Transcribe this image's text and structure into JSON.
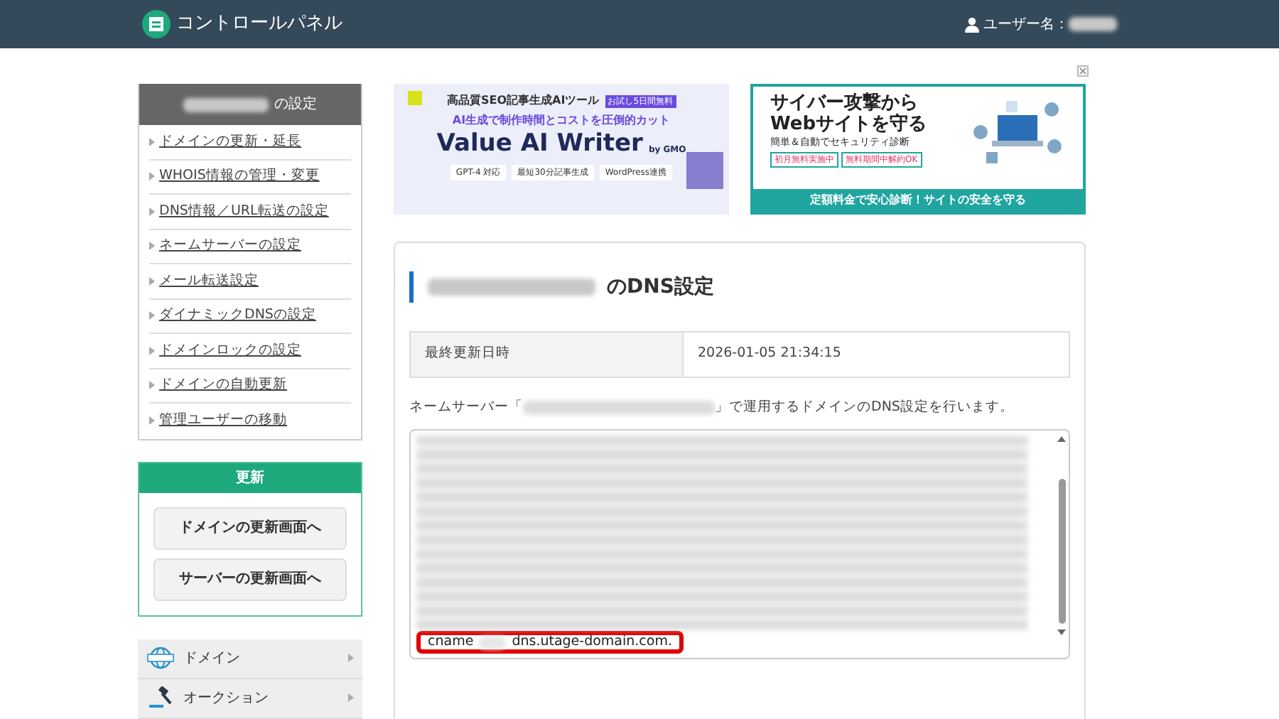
{
  "header": {
    "title": "コントロールパネル",
    "user_label": "ユーザー名："
  },
  "sidebar": {
    "settings_title_suffix": "の設定",
    "links": [
      "ドメインの更新・延長",
      "WHOIS情報の管理・変更",
      "DNS情報／URL転送の設定",
      "ネームサーバーの設定",
      "メール転送設定",
      "ダイナミックDNSの設定",
      "ドメインロックの設定",
      "ドメインの自動更新",
      "管理ユーザーの移動"
    ],
    "update_panel": {
      "title": "更新",
      "buttons": [
        "ドメインの更新画面へ",
        "サーバーの更新画面へ"
      ]
    },
    "category_menu": [
      {
        "kind": "domain",
        "label": "ドメイン"
      },
      {
        "kind": "auction",
        "label": "オークション"
      }
    ]
  },
  "ads": [
    {
      "kind": "seo",
      "headline": "高品質SEO記事生成AIツール",
      "badge": "お試し5日間無料",
      "tagline": "AI生成で制作時間とコストを圧倒的カット",
      "product": "Value AI Writer",
      "maker": "by GMO",
      "features": [
        "GPT-4 対応",
        "最短30分記事生成",
        "WordPress連携"
      ]
    },
    {
      "kind": "security",
      "headline": "サイバー攻撃から",
      "headline_2": "Webサイトを守る",
      "tagline": "簡単＆自動でセキュリティ診断",
      "tags": [
        "初月無料実施中",
        "無料期間中解約OK"
      ],
      "footer": "定額料金で安心診断！サイトの安全を守る"
    }
  ],
  "dns": {
    "heading_suffix": "のDNS設定",
    "info_rows": [
      {
        "label": "最終更新日時",
        "value": "2026-01-05 21:34:15"
      }
    ],
    "description_before": "ネームサーバー「",
    "description_after": "」で運用するドメインのDNS設定を行います。",
    "record": {
      "type": "cname",
      "target": "dns.utage-domain.com."
    }
  }
}
